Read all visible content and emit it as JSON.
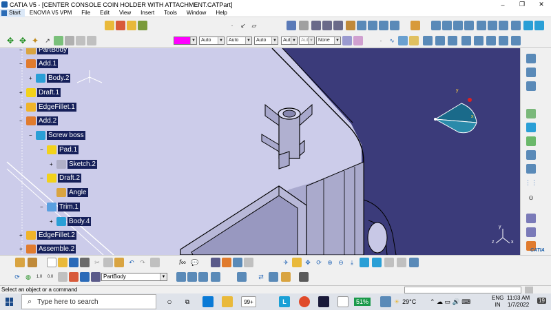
{
  "window": {
    "title": "CATIA V5 - [CENTER CONSOLE COIN HOLDER WITH ATTACHMENT.CATPart]",
    "controls": [
      "–",
      "❐",
      "✕"
    ]
  },
  "menu": {
    "start": "Start",
    "items": [
      "ENOVIA V5 VPM",
      "File",
      "Edit",
      "View",
      "Insert",
      "Tools",
      "Window",
      "Help"
    ]
  },
  "properties_toolbar": {
    "color": "#ff00ff",
    "line_type": "Auto",
    "line_weight": "Auto",
    "point_type": "Auto",
    "layer_a": "Aut",
    "layer_b": "Aut",
    "layer": "None"
  },
  "spec_tree": {
    "nodes": [
      {
        "label": "PartBody",
        "icon": "partbody-icon",
        "color": "#d9a441"
      },
      {
        "label": "Add.1",
        "icon": "add-icon",
        "color": "#e07b2e"
      },
      {
        "label": "Body.2",
        "icon": "body-icon",
        "color": "#2a9fd6"
      },
      {
        "label": "Draft.1",
        "icon": "draft-icon",
        "color": "#f2d21b"
      },
      {
        "label": "EdgeFillet.1",
        "icon": "edgefillet-icon",
        "color": "#f0b429"
      },
      {
        "label": "Add.2",
        "icon": "add-icon",
        "color": "#e07b2e"
      },
      {
        "label": "Screw boss",
        "icon": "body-icon",
        "color": "#2a9fd6"
      },
      {
        "label": "Pad.1",
        "icon": "pad-icon",
        "color": "#f2d21b"
      },
      {
        "label": "Sketch.2",
        "icon": "sketch-icon",
        "color": "#b0b0c8"
      },
      {
        "label": "Draft.2",
        "icon": "draft-icon",
        "color": "#f2d21b"
      },
      {
        "label": "Angle",
        "icon": "angle-icon",
        "color": "#d9a441"
      },
      {
        "label": "Trim.1",
        "icon": "trim-icon",
        "color": "#5aa0e0"
      },
      {
        "label": "Body.4",
        "icon": "body-icon",
        "color": "#2a9fd6"
      },
      {
        "label": "EdgeFillet.2",
        "icon": "edgefillet-icon",
        "color": "#f0b429"
      },
      {
        "label": "Assemble.2",
        "icon": "assemble-icon",
        "color": "#e07b2e"
      }
    ]
  },
  "compass": {
    "x": "x",
    "y": "y",
    "z": "z"
  },
  "axis_widget": {
    "x": "x",
    "y": "y",
    "z": "z"
  },
  "brand": "CATIA",
  "bottom_toolbar": {
    "current_body": "PartBody"
  },
  "status": {
    "message": "Select an object or a command"
  },
  "taskbar": {
    "search_placeholder": "Type here to search",
    "badge_count": "99+",
    "battery": "51%",
    "temperature": "29°C",
    "language": "ENG",
    "region": "IN",
    "time": "11:03 AM",
    "date": "1/7/2022",
    "notifications": "19"
  },
  "colors": {
    "viewport_bg": "#9e9ec8",
    "tree_highlight": "#16205a",
    "accent_blue": "#1b5faa"
  }
}
